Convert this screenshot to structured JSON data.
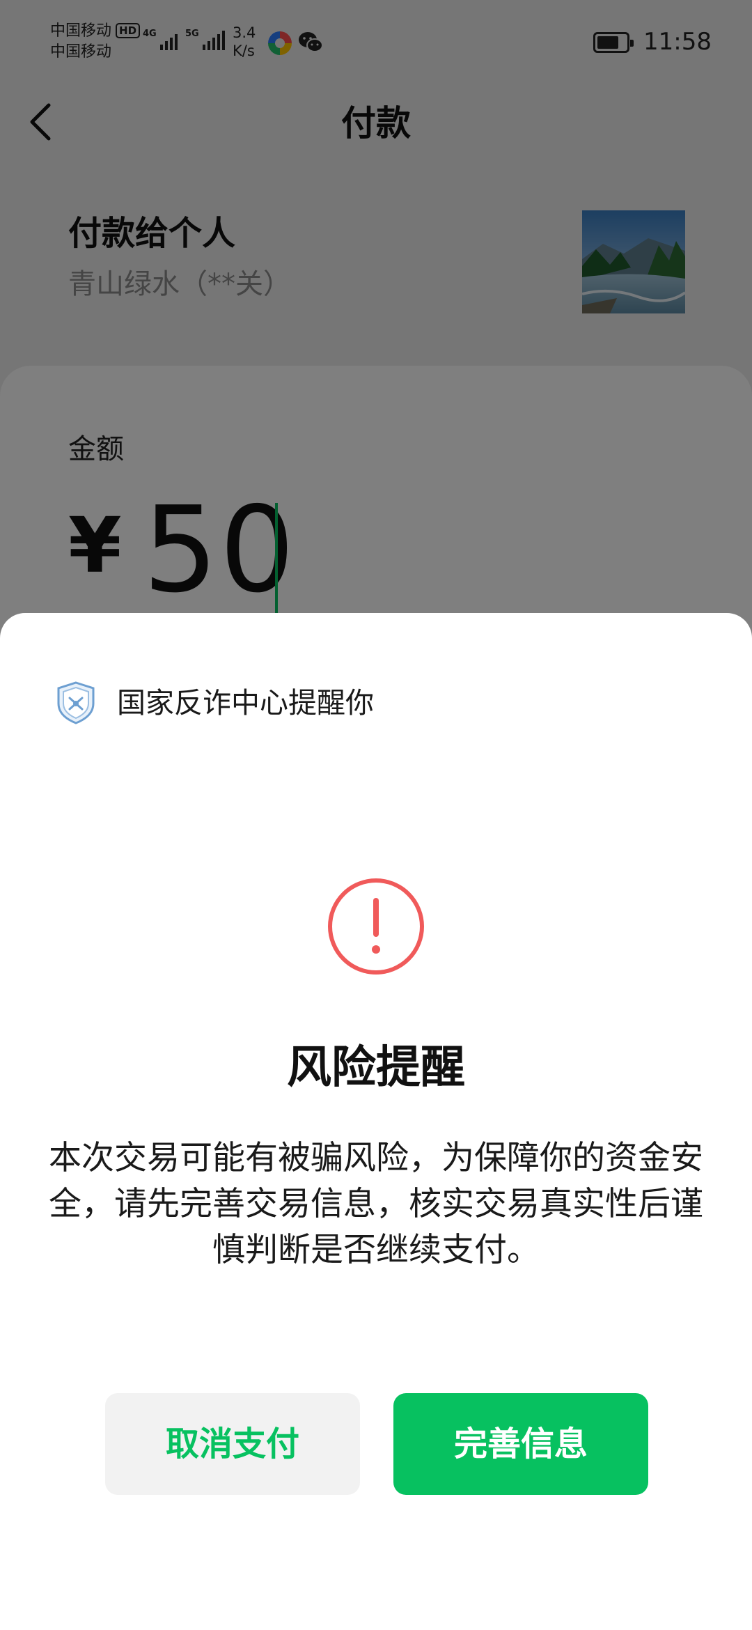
{
  "status_bar": {
    "carrier_1": "中国移动",
    "hd_badge": "HD",
    "carrier_2": "中国移动",
    "signal_1_label": "4G",
    "signal_2_label": "5G",
    "speed_value": "3.4",
    "speed_unit": "K/s",
    "time": "11:58"
  },
  "nav": {
    "title": "付款"
  },
  "payee": {
    "title": "付款给个人",
    "name": "青山绿水（**关）"
  },
  "amount": {
    "label": "金额",
    "currency": "¥",
    "value": "50"
  },
  "sheet": {
    "header_text": "国家反诈中心提醒你",
    "alert_title": "风险提醒",
    "alert_message": "本次交易可能有被骗风险，为保障你的资金安全，请先完善交易信息，核实交易真实性后谨慎判断是否继续支付。",
    "cancel_label": "取消支付",
    "complete_label": "完善信息"
  },
  "colors": {
    "accent": "#07c160",
    "alert": "#f05a5a"
  }
}
